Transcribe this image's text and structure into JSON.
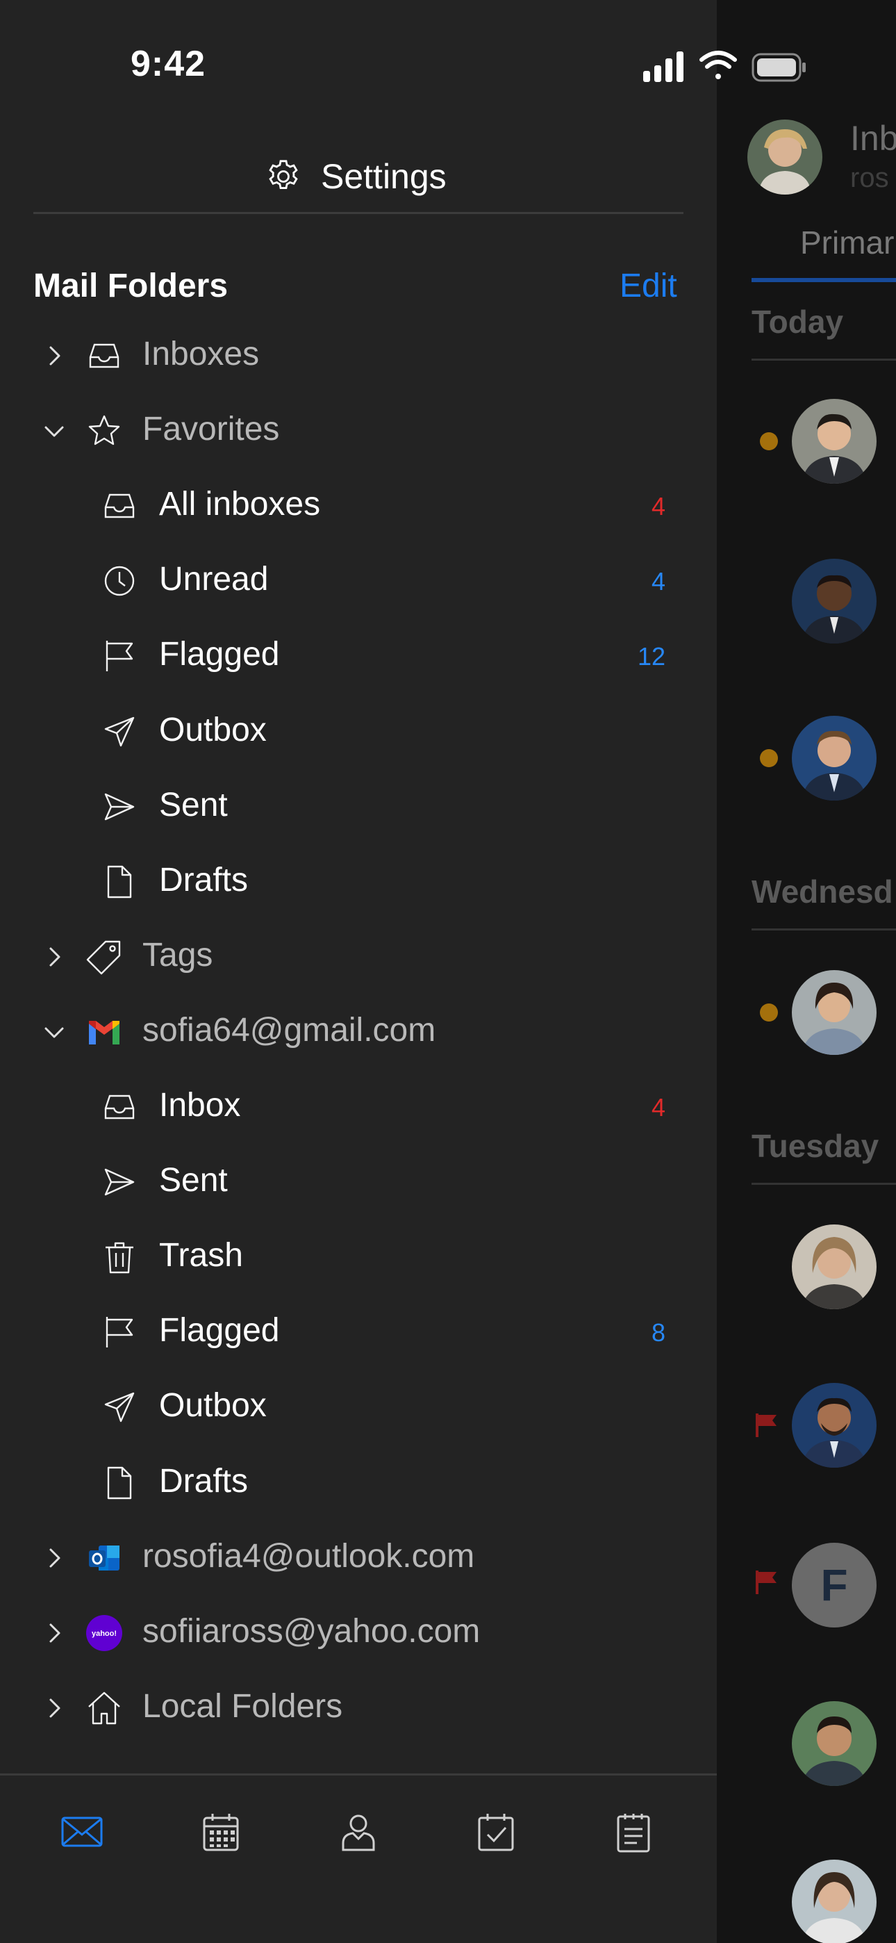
{
  "status_bar": {
    "time": "9:42"
  },
  "header": {
    "settings_label": "Settings"
  },
  "mail_folders": {
    "title": "Mail Folders",
    "edit_label": "Edit",
    "rows": [
      {
        "name": "inboxes",
        "label": "Inboxes",
        "icon": "inbox-icon",
        "level": 0,
        "chevron": "right",
        "count": "",
        "count_color": ""
      },
      {
        "name": "favorites",
        "label": "Favorites",
        "icon": "star-icon",
        "level": 0,
        "chevron": "down",
        "count": "",
        "count_color": ""
      },
      {
        "name": "all-inboxes",
        "label": "All inboxes",
        "icon": "inbox-icon",
        "level": 1,
        "chevron": "",
        "count": "4",
        "count_color": "red"
      },
      {
        "name": "unread",
        "label": "Unread",
        "icon": "clock-icon",
        "level": 1,
        "chevron": "",
        "count": "4",
        "count_color": "blue"
      },
      {
        "name": "flagged",
        "label": "Flagged",
        "icon": "flag-icon",
        "level": 1,
        "chevron": "",
        "count": "12",
        "count_color": "blue"
      },
      {
        "name": "outbox",
        "label": "Outbox",
        "icon": "outbox-icon",
        "level": 1,
        "chevron": "",
        "count": "",
        "count_color": ""
      },
      {
        "name": "sent",
        "label": "Sent",
        "icon": "sent-icon",
        "level": 1,
        "chevron": "",
        "count": "",
        "count_color": ""
      },
      {
        "name": "drafts",
        "label": "Drafts",
        "icon": "draft-icon",
        "level": 1,
        "chevron": "",
        "count": "",
        "count_color": ""
      },
      {
        "name": "tags",
        "label": "Tags",
        "icon": "tag-icon",
        "level": 0,
        "chevron": "right",
        "count": "",
        "count_color": ""
      },
      {
        "name": "gmail-account",
        "label": "sofia64@gmail.com",
        "icon": "gmail-icon",
        "level": 0,
        "chevron": "down",
        "count": "",
        "count_color": ""
      },
      {
        "name": "gmail-inbox",
        "label": "Inbox",
        "icon": "inbox-icon",
        "level": 1,
        "chevron": "",
        "count": "4",
        "count_color": "red"
      },
      {
        "name": "gmail-sent",
        "label": "Sent",
        "icon": "sent-icon",
        "level": 1,
        "chevron": "",
        "count": "",
        "count_color": ""
      },
      {
        "name": "gmail-trash",
        "label": "Trash",
        "icon": "trash-icon",
        "level": 1,
        "chevron": "",
        "count": "",
        "count_color": ""
      },
      {
        "name": "gmail-flagged",
        "label": "Flagged",
        "icon": "flag-icon",
        "level": 1,
        "chevron": "",
        "count": "8",
        "count_color": "blue"
      },
      {
        "name": "gmail-outbox",
        "label": "Outbox",
        "icon": "outbox-icon",
        "level": 1,
        "chevron": "",
        "count": "",
        "count_color": ""
      },
      {
        "name": "gmail-drafts",
        "label": "Drafts",
        "icon": "draft-icon",
        "level": 1,
        "chevron": "",
        "count": "",
        "count_color": ""
      },
      {
        "name": "outlook-account",
        "label": "rosofia4@outlook.com",
        "icon": "outlook-icon",
        "level": 0,
        "chevron": "right",
        "count": "",
        "count_color": ""
      },
      {
        "name": "yahoo-account",
        "label": "sofiiaross@yahoo.com",
        "icon": "yahoo-icon",
        "level": 0,
        "chevron": "right",
        "count": "",
        "count_color": ""
      },
      {
        "name": "local-folders",
        "label": "Local Folders",
        "icon": "home-icon",
        "level": 0,
        "chevron": "right",
        "count": "",
        "count_color": ""
      }
    ]
  },
  "tab_bar": [
    {
      "name": "mail",
      "icon": "mail-icon",
      "active": true
    },
    {
      "name": "calendar",
      "icon": "calendar-icon",
      "active": false
    },
    {
      "name": "contacts",
      "icon": "contacts-icon",
      "active": false
    },
    {
      "name": "tasks",
      "icon": "tasks-icon",
      "active": false
    },
    {
      "name": "notes",
      "icon": "notes-icon",
      "active": false
    }
  ],
  "background_mail": {
    "title": "Inb",
    "subtitle": "ros",
    "tab": "Primar",
    "sections": [
      "Today",
      "Wednesd",
      "Tuesday"
    ]
  },
  "colors": {
    "accent": "#1c7cf0",
    "count_red": "#e12a2a",
    "count_blue": "#2787f5",
    "unread_dot": "#a4700c",
    "flag_red": "#8e1b1b"
  }
}
